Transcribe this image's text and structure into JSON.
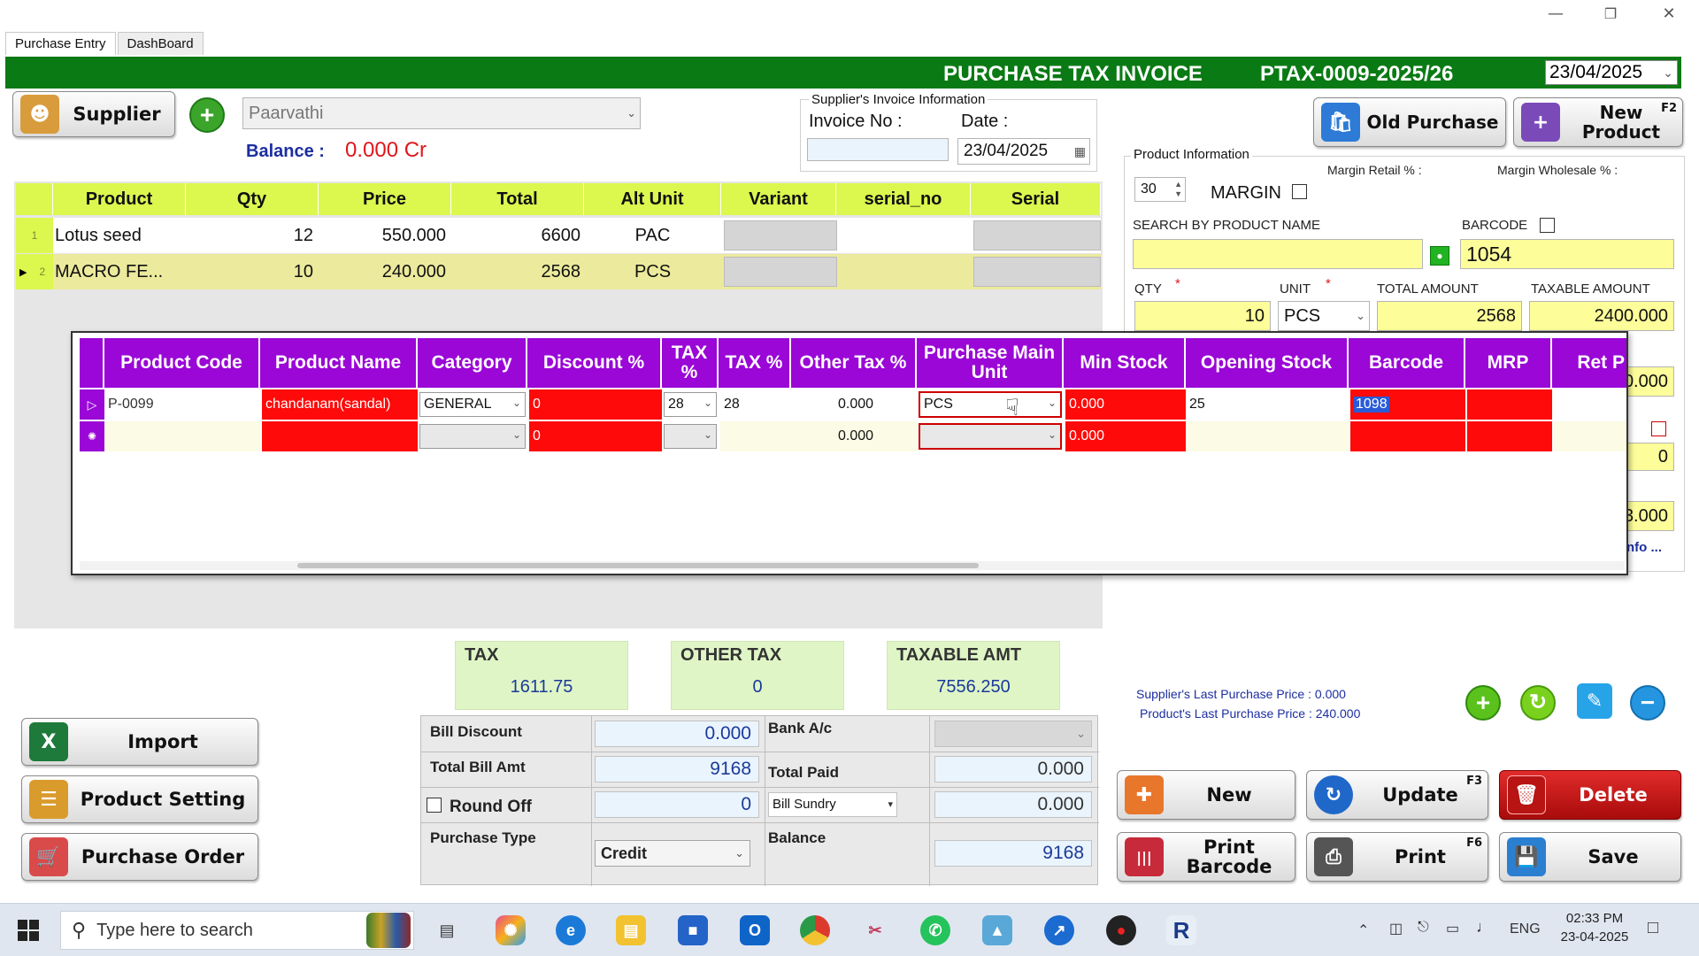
{
  "tabs": [
    "Purchase Entry",
    "DashBoard"
  ],
  "header": {
    "title": "PURCHASE TAX INVOICE",
    "invoice_id": "PTAX-0009-2025/26",
    "date": "23/04/2025"
  },
  "supplier": {
    "button_label": "Supplier",
    "name": "Paarvathi",
    "balance_label": "Balance :",
    "balance_value": "0.000 Cr"
  },
  "supplier_invoice": {
    "group_title": "Supplier's Invoice Information",
    "invoice_no_label": "Invoice No :",
    "invoice_no": "",
    "date_label": "Date :",
    "date": "23/04/2025"
  },
  "top_buttons": {
    "old_purchase": "Old Purchase",
    "new_product": "New Product",
    "new_product_key": "F2"
  },
  "product_grid": {
    "columns": [
      "Product",
      "Qty",
      "Price",
      "Total",
      "Alt Unit",
      "Variant",
      "serial_no",
      "Serial"
    ],
    "rows": [
      {
        "num": "1",
        "product": "Lotus seed",
        "qty": "12",
        "price": "550.000",
        "total": "6600",
        "alt_unit": "PAC"
      },
      {
        "num": "2",
        "product": "MACRO FE...",
        "qty": "10",
        "price": "240.000",
        "total": "2568",
        "alt_unit": "PCS"
      }
    ]
  },
  "product_info": {
    "group_title": "Product Information",
    "spin_value": "30",
    "margin_label": "MARGIN",
    "margin_retail_label": "Margin Retail % :",
    "margin_wholesale_label": "Margin Wholesale % :",
    "search_label": "SEARCH BY PRODUCT NAME",
    "search_value": "",
    "barcode_label": "BARCODE",
    "barcode_value": "1054",
    "qty_label": "QTY",
    "unit_label": "UNIT",
    "total_amount_label": "TOTAL AMOUNT",
    "taxable_amount_label": "TAXABLE AMOUNT",
    "required_mark": "*",
    "qty_value": "10",
    "unit_value": "PCS",
    "total_amount_value": "2568",
    "taxable_amount_value": "2400.000",
    "partial_1": "0.000",
    "partial_2": "0",
    "partial_3": "3.000",
    "partial_info": "nfo ...",
    "last_purchase_supplier_label": "Supplier's Last Purchase Price :",
    "last_purchase_supplier_value": "0.000",
    "last_purchase_product_label": "Product's Last Purchase Price :",
    "last_purchase_product_value": "240.000"
  },
  "new_product_table": {
    "columns": [
      "Product Code",
      "Product Name",
      "Category",
      "Discount %",
      "TAX %",
      "TAX %",
      "Other Tax %",
      "Purchase Main Unit",
      "Min Stock",
      "Opening Stock",
      "Barcode",
      "MRP",
      "Ret P"
    ],
    "rows": [
      {
        "code": "P-0099",
        "name": "chandanam(sandal)",
        "category": "GENERAL",
        "discount": "0",
        "tax_sel": "28",
        "tax": "28",
        "other_tax": "0.000",
        "unit": "PCS",
        "min_stock": "0.000",
        "opening_stock": "25",
        "barcode": "1098",
        "mrp": ""
      },
      {
        "code": "",
        "name": "",
        "category": "",
        "discount": "0",
        "tax_sel": "",
        "tax": "",
        "other_tax": "0.000",
        "unit": "",
        "min_stock": "0.000",
        "opening_stock": "",
        "barcode": "",
        "mrp": ""
      }
    ]
  },
  "summary": {
    "tax_label": "TAX",
    "tax_value": "1611.75",
    "other_tax_label": "OTHER TAX",
    "other_tax_value": "0",
    "taxable_label": "TAXABLE AMT",
    "taxable_value": "7556.250"
  },
  "bill": {
    "bill_discount_label": "Bill Discount",
    "bill_discount": "0.000",
    "bank_label": "Bank A/c",
    "bank_value": "",
    "total_bill_label": "Total Bill Amt",
    "total_bill": "9168",
    "total_paid_label": "Total Paid",
    "total_paid": "0.000",
    "round_off_label": "Round Off",
    "round_off": "0",
    "bill_sundry_label": "Bill Sundry",
    "bill_sundry": "0.000",
    "purchase_type_label": "Purchase Type",
    "purchase_type": "Credit",
    "balance_label": "Balance",
    "balance": "9168"
  },
  "left_buttons": {
    "import": "Import",
    "product_setting": "Product Setting",
    "purchase_order": "Purchase Order"
  },
  "action_buttons": {
    "new": "New",
    "update": "Update",
    "update_key": "F3",
    "delete": "Delete",
    "print_barcode": "Print Barcode",
    "print": "Print",
    "print_key": "F6",
    "save": "Save"
  },
  "taskbar": {
    "search_placeholder": "Type here to search",
    "lang": "ENG",
    "time": "02:33 PM",
    "date": "23-04-2025"
  },
  "colors": {
    "title_green": "#0a7a14",
    "grid_header": "#dcf74e",
    "overlay_header": "#9a07d6",
    "error_red": "#ff0a0a",
    "input_yellow": "#fdfd9a",
    "delete_red": "#cc1111"
  }
}
